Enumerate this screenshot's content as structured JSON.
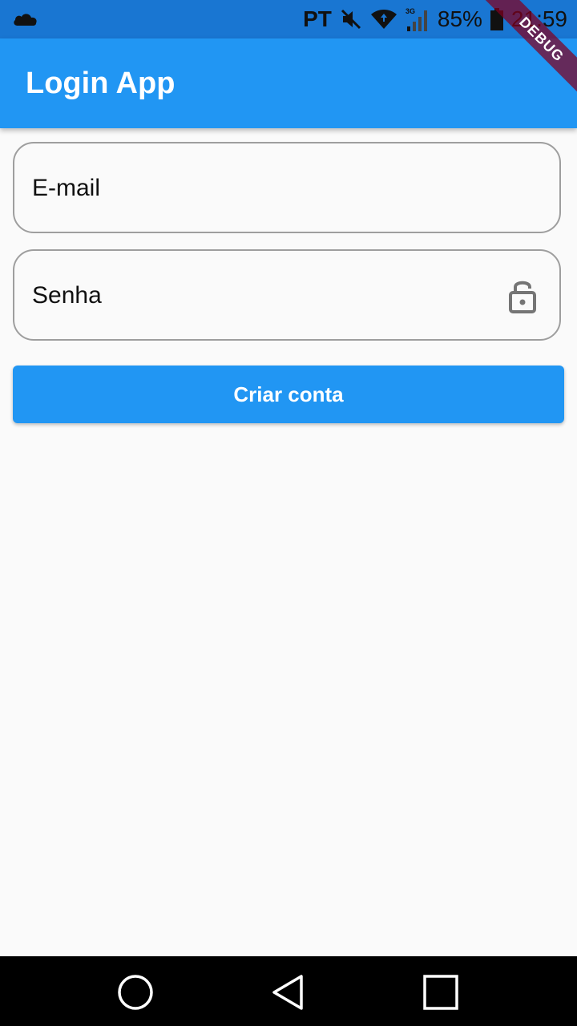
{
  "status_bar": {
    "left_icon": "cloud-icon",
    "language": "PT",
    "mute_icon": "mute-icon",
    "wifi_icon": "wifi-icon",
    "signal_label": "3G",
    "battery_percent": "85%",
    "battery_icon": "battery-icon",
    "time": "21:59"
  },
  "debug_banner": {
    "label": "DEBUG"
  },
  "app_bar": {
    "title": "Login App"
  },
  "form": {
    "email": {
      "label": "E-mail"
    },
    "senha": {
      "label": "Senha",
      "icon": "lock-icon"
    },
    "submit_label": "Criar conta"
  },
  "nav_bar": {
    "home_icon": "home-circle-icon",
    "back_icon": "back-triangle-icon",
    "recent_icon": "recent-square-icon"
  },
  "colors": {
    "status_bar": "#1976d2",
    "primary": "#2196f3",
    "background": "#fafafa",
    "field_border": "#9e9e9e",
    "debug_banner": "#800020"
  }
}
